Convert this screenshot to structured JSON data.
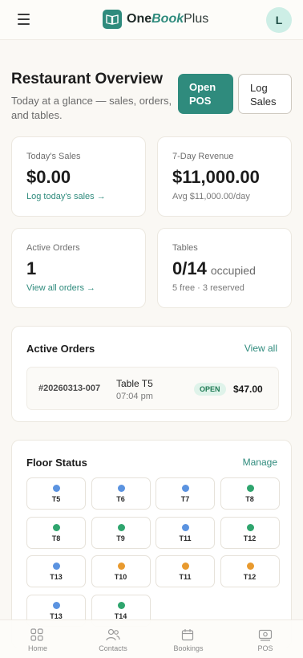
{
  "app": {
    "brand_one": "One",
    "brand_book": "Book",
    "brand_plus": "Plus",
    "avatar_initial": "L"
  },
  "header": {
    "title": "Restaurant Overview",
    "subtitle": "Today at a glance — sales, orders, and tables.",
    "open_pos_line1": "Open",
    "open_pos_line2": "POS",
    "log_sales_line1": "Log",
    "log_sales_line2": "Sales"
  },
  "stats": {
    "today_sales": {
      "label": "Today's Sales",
      "value": "$0.00",
      "link": "Log today's sales →"
    },
    "revenue_7d": {
      "label": "7-Day Revenue",
      "value": "$11,000.00",
      "note": "Avg $11,000.00/day"
    },
    "active_orders": {
      "label": "Active Orders",
      "value": "1",
      "link": "View all orders →"
    },
    "tables": {
      "label": "Tables",
      "value": "0/14",
      "unit": "occupied",
      "note": "5 free · 3 reserved"
    }
  },
  "active_orders_section": {
    "title": "Active Orders",
    "link": "View all",
    "orders": [
      {
        "id": "#20260313-007",
        "table": "Table T5",
        "time": "07:04 pm",
        "status": "OPEN",
        "amount": "$47.00"
      }
    ]
  },
  "floor_status": {
    "title": "Floor Status",
    "link": "Manage",
    "tables": [
      {
        "label": "T5",
        "status": "blue"
      },
      {
        "label": "T6",
        "status": "blue"
      },
      {
        "label": "T7",
        "status": "blue"
      },
      {
        "label": "T8",
        "status": "green"
      },
      {
        "label": "T8",
        "status": "green"
      },
      {
        "label": "T9",
        "status": "green"
      },
      {
        "label": "T11",
        "status": "blue"
      },
      {
        "label": "T12",
        "status": "green"
      },
      {
        "label": "T13",
        "status": "blue"
      },
      {
        "label": "T10",
        "status": "orange"
      },
      {
        "label": "T11",
        "status": "orange"
      },
      {
        "label": "T12",
        "status": "orange"
      },
      {
        "label": "T13",
        "status": "blue"
      },
      {
        "label": "T14",
        "status": "green"
      }
    ]
  },
  "status_colors": {
    "blue": "#5b93e0",
    "green": "#2fa56e",
    "orange": "#e89a2f"
  },
  "bottom_nav": {
    "home": "Home",
    "contacts": "Contacts",
    "bookings": "Bookings",
    "pos": "POS"
  }
}
